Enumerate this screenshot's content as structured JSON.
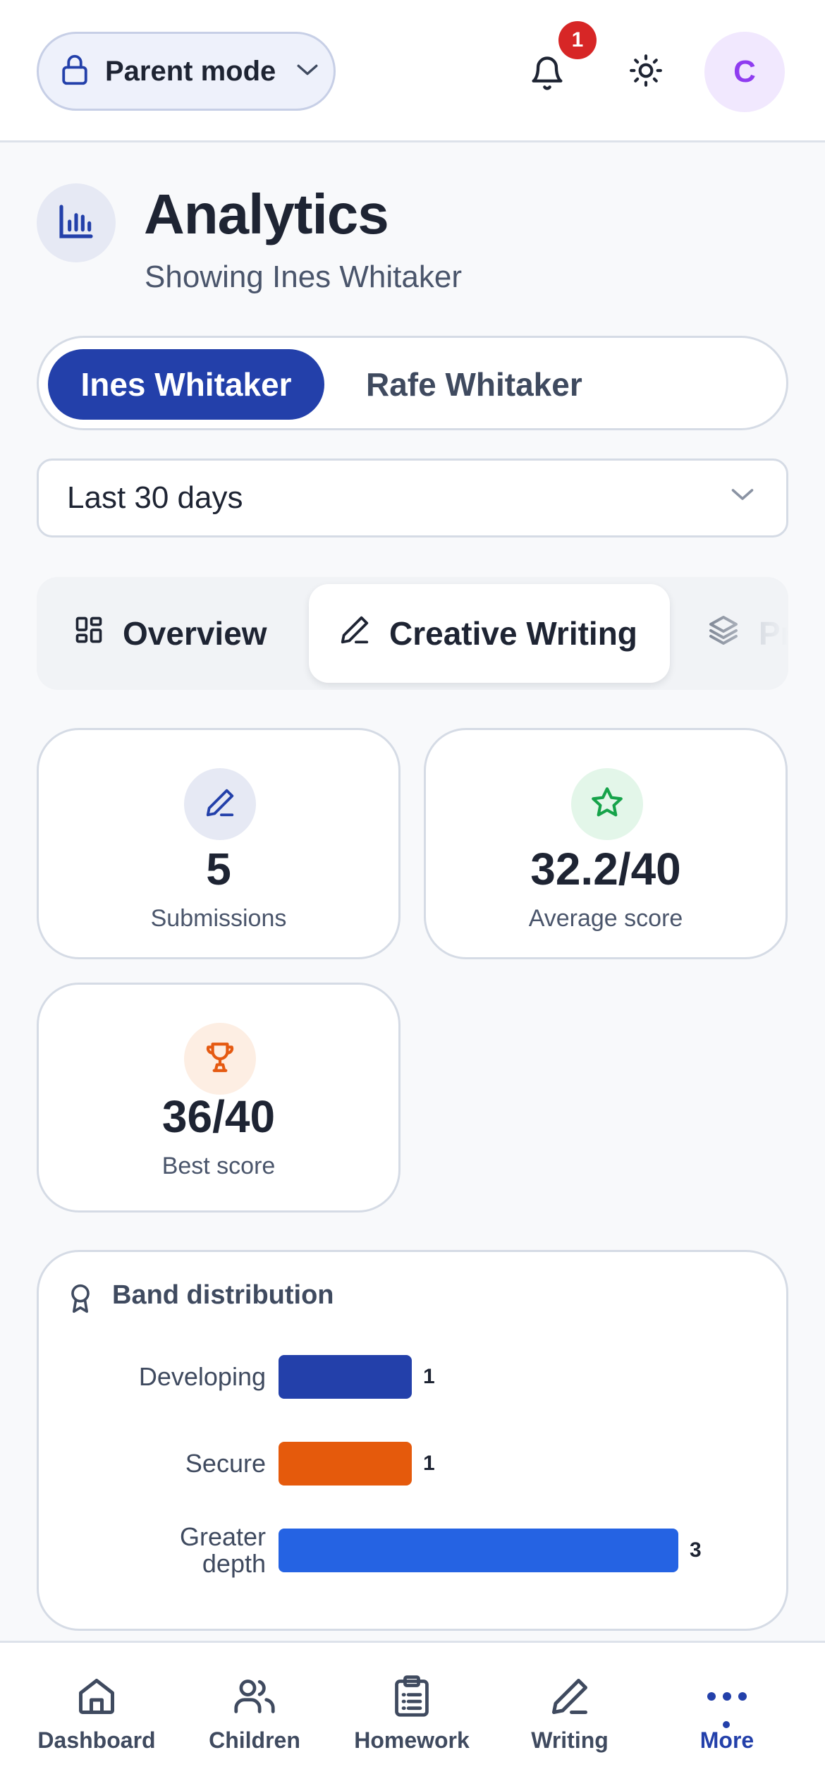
{
  "topbar": {
    "mode_label": "Parent mode",
    "notification_count": "1",
    "avatar_initial": "C"
  },
  "header": {
    "title": "Analytics",
    "subtitle": "Showing Ines Whitaker"
  },
  "children": [
    {
      "name": "Ines Whitaker",
      "active": true
    },
    {
      "name": "Rafe Whitaker",
      "active": false
    }
  ],
  "range": {
    "selected": "Last 30 days"
  },
  "tabs": [
    {
      "label": "Overview",
      "icon": "grid-icon",
      "active": false
    },
    {
      "label": "Creative Writing",
      "icon": "pencil-icon",
      "active": true
    },
    {
      "label": "Pr",
      "icon": "layers-icon",
      "active": false
    }
  ],
  "stats": [
    {
      "value": "5",
      "label": "Submissions",
      "icon": "pencil-icon",
      "color": "#2340aa",
      "bg": "#e6e9f4"
    },
    {
      "value": "32.2/40",
      "label": "Average score",
      "icon": "star-icon",
      "color": "#16a34a",
      "bg": "#e3f6e9"
    },
    {
      "value": "36/40",
      "label": "Best score",
      "icon": "trophy-icon",
      "color": "#e55a12",
      "bg": "#fdeee3"
    }
  ],
  "band_distribution": {
    "title": "Band distribution",
    "icon": "award-icon"
  },
  "chart_data": {
    "type": "bar",
    "orientation": "horizontal",
    "categories": [
      "Developing",
      "Secure",
      "Greater depth"
    ],
    "values": [
      1,
      1,
      3
    ],
    "colors": [
      "#2340aa",
      "#e55a0c",
      "#2563e3"
    ]
  },
  "nav": [
    {
      "label": "Dashboard",
      "icon": "home-icon",
      "active": false
    },
    {
      "label": "Children",
      "icon": "users-icon",
      "active": false
    },
    {
      "label": "Homework",
      "icon": "clipboard-icon",
      "active": false
    },
    {
      "label": "Writing",
      "icon": "pencil-icon",
      "active": false
    },
    {
      "label": "More",
      "icon": "more-icon",
      "active": true
    }
  ],
  "theme": {
    "accent": "#2340aa",
    "badge": "#d72626",
    "avatar": "#8f3cf0"
  }
}
